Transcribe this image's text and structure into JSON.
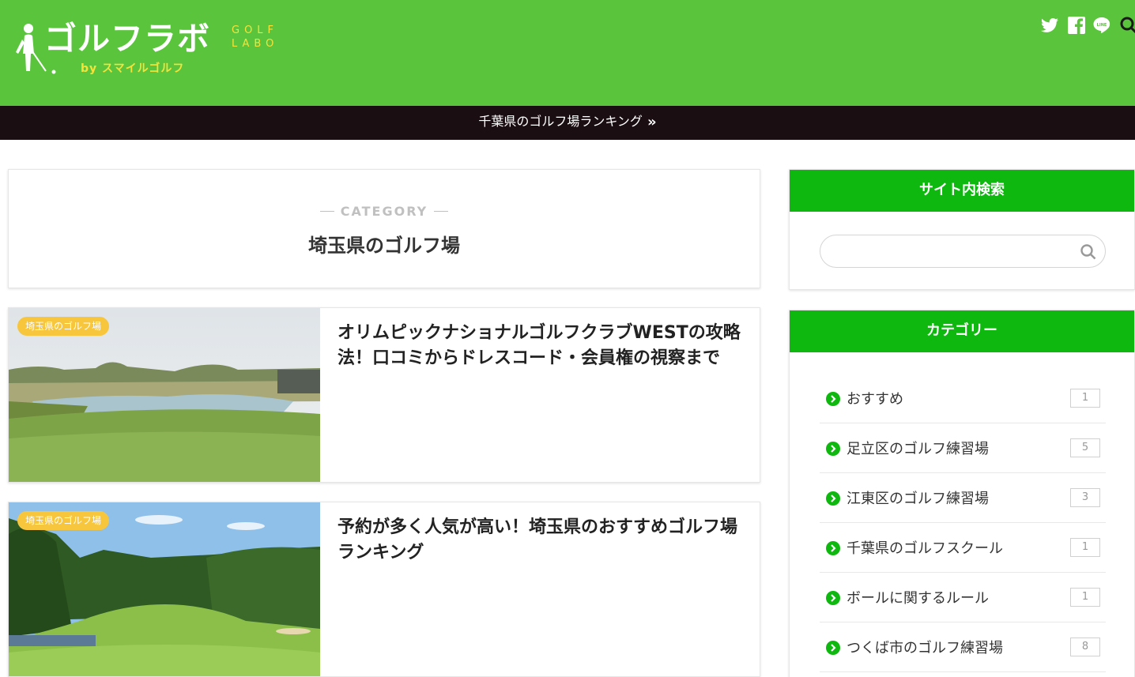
{
  "site": {
    "logo_main": "ゴルフラボ",
    "logo_en_line1": "GOLF",
    "logo_en_line2": "LABO",
    "logo_sub": "by スマイルゴルフ",
    "header_icons": [
      "twitter-icon",
      "facebook-icon",
      "line-icon",
      "search-icon"
    ]
  },
  "nav": {
    "link_label": "千葉県のゴルフ場ランキング",
    "chevron": "»"
  },
  "category": {
    "label": "CATEGORY",
    "title": "埼玉県のゴルフ場"
  },
  "posts": [
    {
      "badge": "埼玉県のゴルフ場",
      "title": "オリムピックナショナルゴルフクラブWESTの攻略法！口コミからドレスコード・会員権の視察まで"
    },
    {
      "badge": "埼玉県のゴルフ場",
      "title": "予約が多く人気が高い！埼玉県のおすすめゴルフ場ランキング"
    }
  ],
  "sidebar": {
    "search": {
      "title": "サイト内検索",
      "placeholder": "",
      "value": ""
    },
    "categories": {
      "title": "カテゴリー",
      "items": [
        {
          "name": "おすすめ",
          "count": "1"
        },
        {
          "name": "足立区のゴルフ練習場",
          "count": "5"
        },
        {
          "name": "江東区のゴルフ練習場",
          "count": "3"
        },
        {
          "name": "千葉県のゴルフスクール",
          "count": "1"
        },
        {
          "name": "ボールに関するルール",
          "count": "1"
        },
        {
          "name": "つくば市のゴルフ練習場",
          "count": "8"
        }
      ]
    }
  },
  "colors": {
    "header_green": "#5ac43d",
    "nav_dark": "#1a0e13",
    "widget_green": "#0eb80e",
    "badge_yellow": "#f7c63d",
    "logo_yellow": "#f5e33a"
  }
}
